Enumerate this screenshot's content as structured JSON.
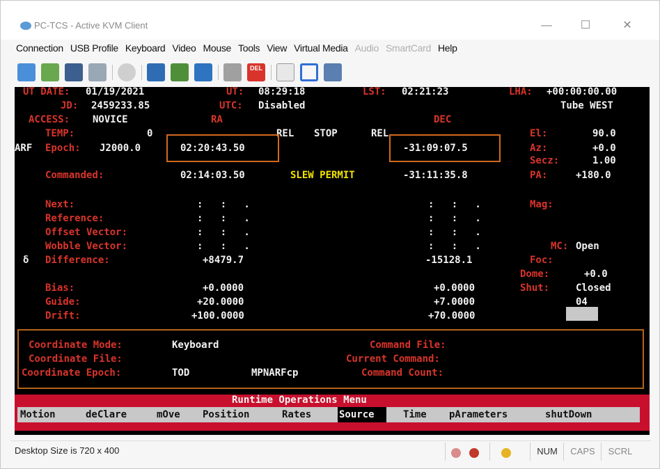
{
  "window": {
    "title": "PC-TCS - Active KVM Client"
  },
  "menu": [
    "Connection",
    "USB Profile",
    "Keyboard",
    "Video",
    "Mouse",
    "Tools",
    "View",
    "Virtual Media",
    "Audio",
    "SmartCard",
    "Help"
  ],
  "menu_disabled": [
    "Audio",
    "SmartCard"
  ],
  "toolbar_icons": [
    "refresh-icon",
    "user-icon",
    "monitor-icon",
    "disk-icon",
    "cd-icon",
    "cursor-icon",
    "macro-icon",
    "keyboard-icon",
    "tools-icon",
    "del-key-icon",
    "arrow-icon",
    "fullscreen-icon",
    "settings-icon"
  ],
  "toolbar_del_label": "DEL",
  "terminal": {
    "ut_date_label": "UT DATE:",
    "ut_date": "01/19/2021",
    "ut_label": "UT:",
    "ut": "08:29:18",
    "lst_label": "LST:",
    "lst": "02:21:23",
    "lha_label": "LHA:",
    "lha": "+00:00:00.00",
    "jd_label": "JD:",
    "jd": "2459233.85",
    "utc_label": "UTC:",
    "utc": "Disabled",
    "tube": "Tube WEST",
    "access_label": "ACCESS:",
    "access": "NOVICE",
    "ra_header": "RA",
    "dec_header": "DEC",
    "temp_label": "TEMP:",
    "temp": "0",
    "rel1": "REL",
    "stop": "STOP",
    "rel2": "REL",
    "el_label": "El:",
    "el": "90.0",
    "arf": "ARF",
    "epoch_label": "Epoch:",
    "epoch": "J2000.0",
    "ra_current": "02:20:43.50",
    "dec_current": "-31:09:07.5",
    "az_label": "Az:",
    "az": "+0.0",
    "secz_label": "Secz:",
    "secz": "1.00",
    "commanded_label": "Commanded:",
    "ra_commanded": "02:14:03.50",
    "slew_permit": "SLEW PERMIT",
    "dec_commanded": "-31:11:35.8",
    "pa_label": "PA:",
    "pa": "+180.0",
    "next_label": "Next:",
    "reference_label": "Reference:",
    "offset_label": "Offset Vector:",
    "wobble_label": "Wobble Vector:",
    "empty_ra": ":   :   .",
    "empty_dec": ":   :   .",
    "mag_label": "Mag:",
    "mc_label": "MC:",
    "mc": "Open",
    "delta_symbol": "δ",
    "difference_label": "Difference:",
    "ra_difference": "+8479.7",
    "dec_difference": "-15128.1",
    "foc_label": "Foc:",
    "dome_label": "Dome:",
    "dome": "+0.0",
    "bias_label": "Bias:",
    "ra_bias": "+0.0000",
    "dec_bias": "+0.0000",
    "shut_label": "Shut:",
    "shut": "Closed",
    "guide_label": "Guide:",
    "ra_guide": "+20.0000",
    "dec_guide": "+7.0000",
    "guide_right": "04",
    "drift_label": "Drift:",
    "ra_drift": "+100.0000",
    "dec_drift": "+70.0000",
    "coord_mode_label": "Coordinate Mode:",
    "coord_mode": "Keyboard",
    "command_file_label": "Command File:",
    "coord_file_label": "Coordinate File:",
    "current_command_label": "Current Command:",
    "coord_epoch_label": "Coordinate Epoch:",
    "coord_epoch": "TOD",
    "mpnarf": "MPNARFcp",
    "command_count_label": "Command Count:"
  },
  "runtime_menu": {
    "title": "Runtime Operations Menu",
    "items": [
      "Motion",
      "deClare",
      "mOve",
      "Position",
      "Rates",
      "Source",
      "Time",
      "pArameters",
      "shutDown"
    ],
    "selected": "Source"
  },
  "statusbar": {
    "desktop_size": "Desktop Size is 720 x 400",
    "num": "NUM",
    "caps": "CAPS",
    "scrl": "SCRL"
  },
  "colors": {
    "terminal_bg": "#000000",
    "terminal_white": "#f2f2f2",
    "terminal_red": "#d9342b",
    "terminal_yellow": "#f2e200",
    "highlight_box": "#d2691e",
    "runtime_menu_bg": "#c8102e"
  }
}
